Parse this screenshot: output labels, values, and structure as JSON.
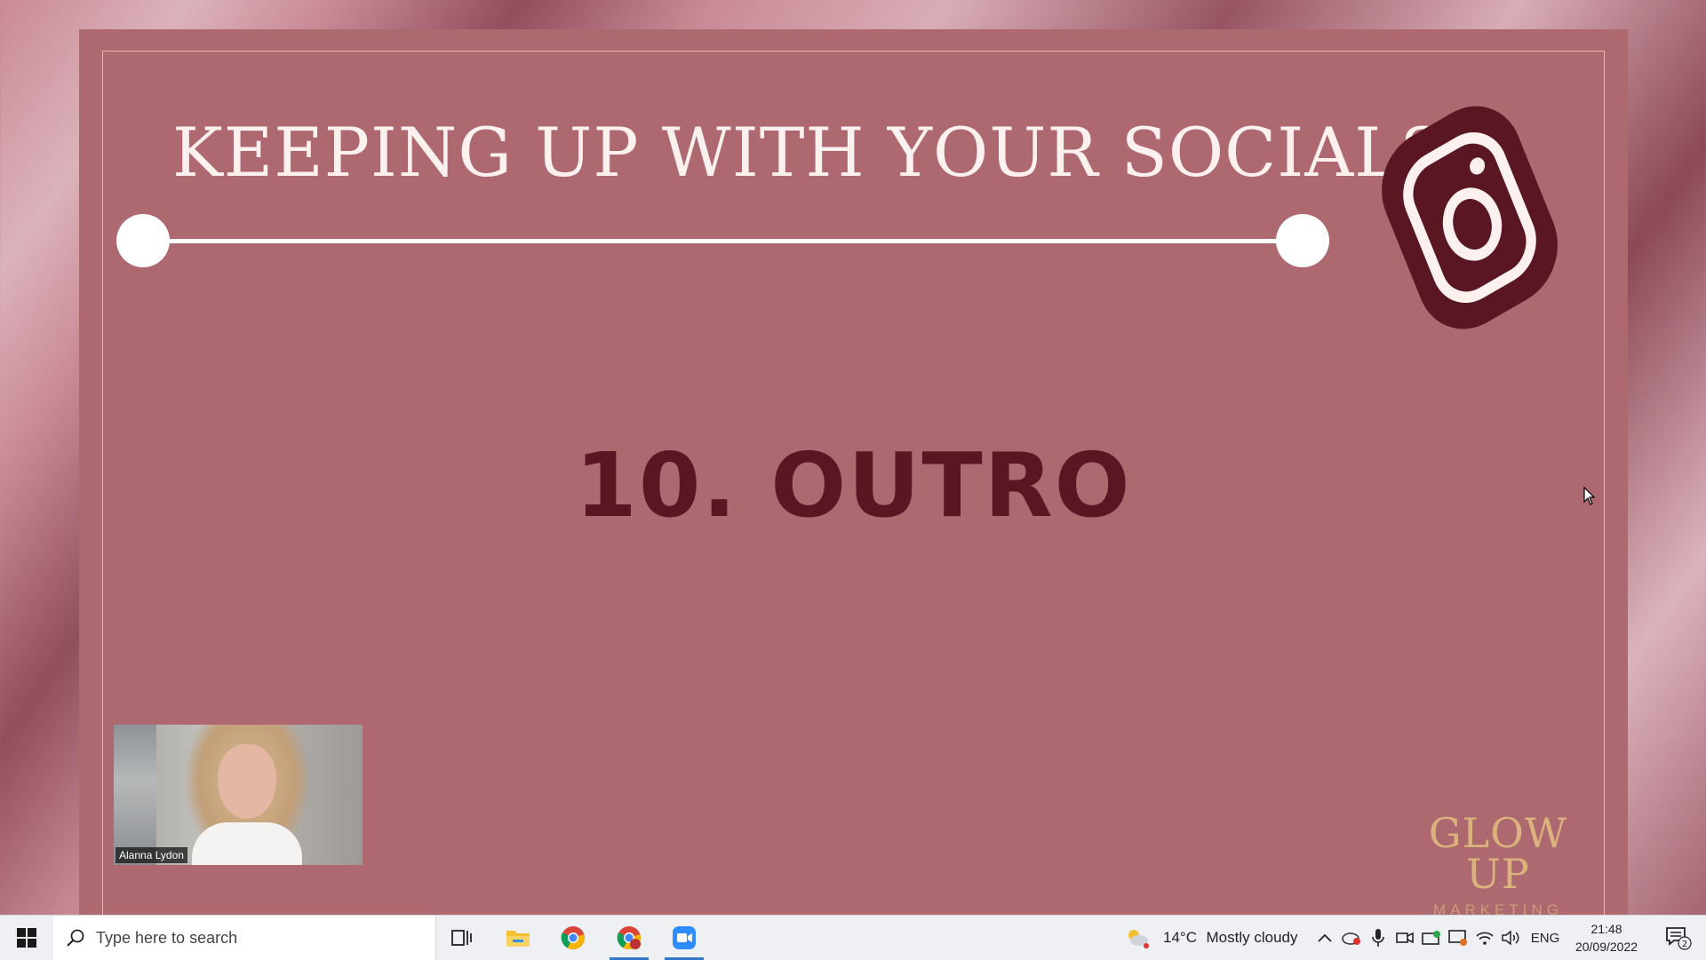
{
  "slide": {
    "title": "KEEPING UP WITH YOUR SOCIALS",
    "section_heading": "10. OUTRO",
    "logo_main": "GLOW UP",
    "logo_sub": "MARKETING",
    "icon": "instagram-icon",
    "colors": {
      "slide_bg": "#ad6870",
      "heading": "#5a1622",
      "logo": "#d9b27d"
    }
  },
  "video": {
    "participant_name": "Alanna Lydon"
  },
  "taskbar": {
    "search_placeholder": "Type here to search",
    "apps": [
      "task-view-icon",
      "file-explorer-icon",
      "chrome-icon",
      "chrome-profile-icon",
      "zoom-icon"
    ],
    "weather_temp": "14°C",
    "weather_desc": "Mostly cloudy",
    "language": "ENG",
    "time": "21:48",
    "date": "20/09/2022",
    "notification_count": "2"
  }
}
